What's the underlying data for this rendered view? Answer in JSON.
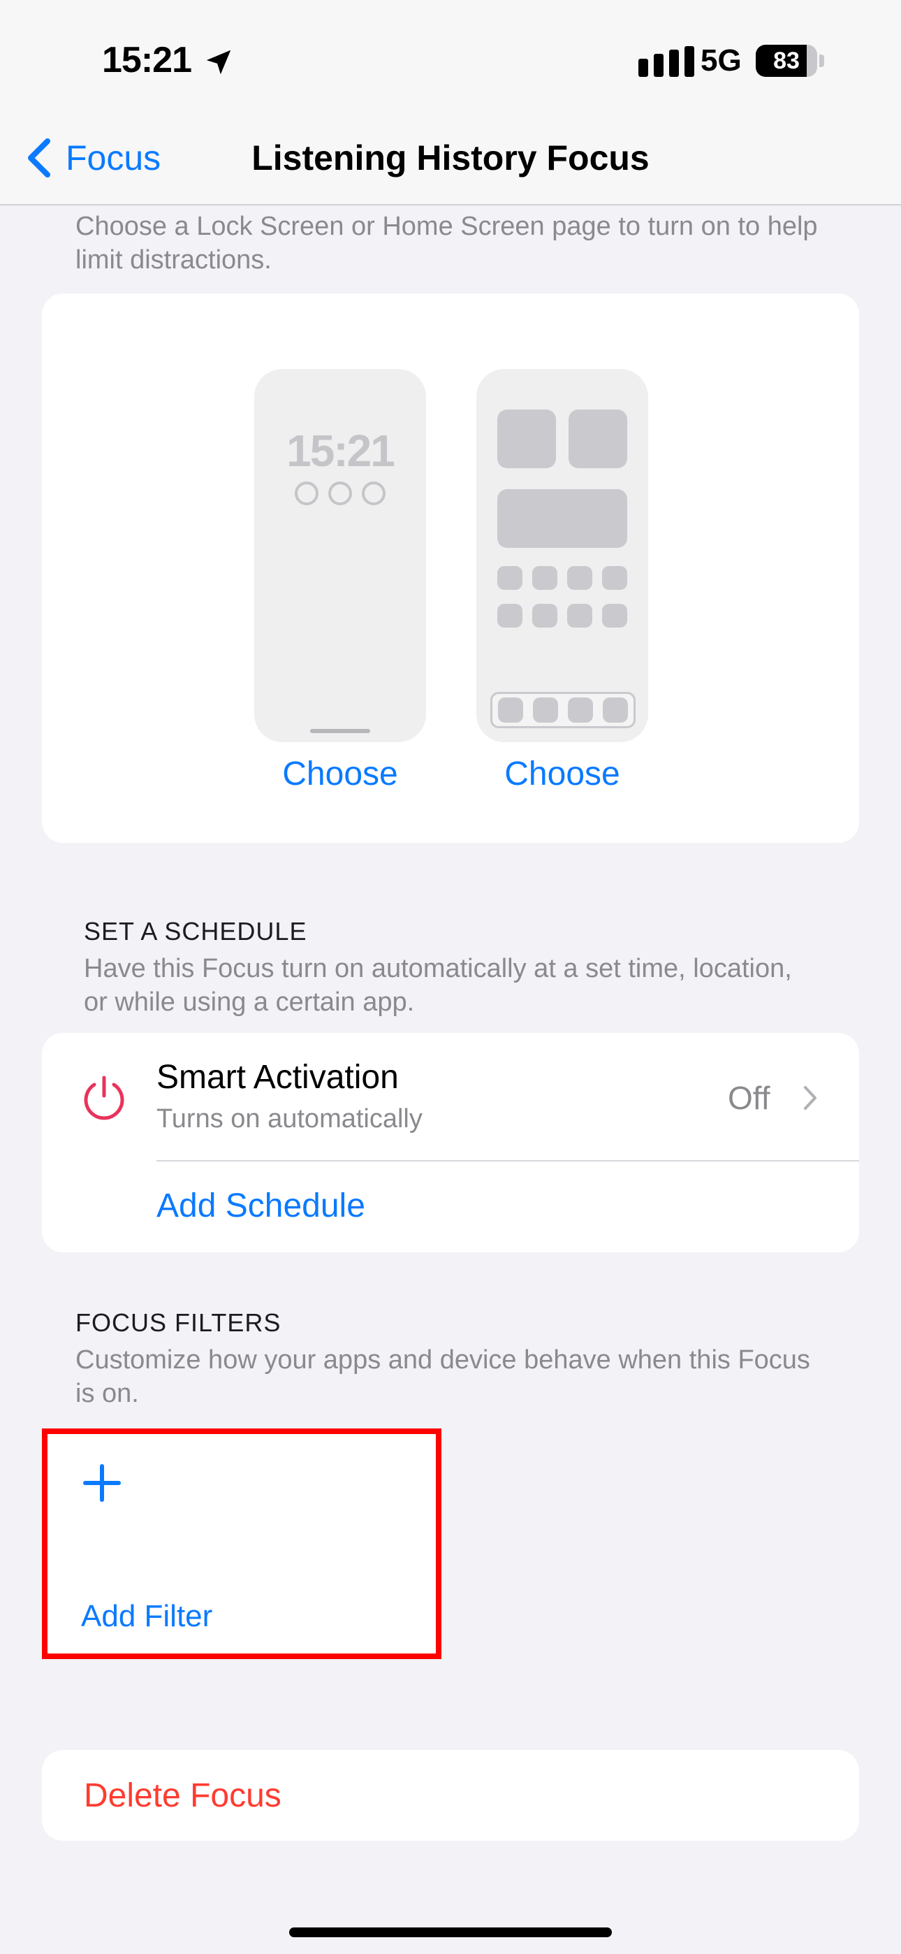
{
  "status_bar": {
    "time": "15:21",
    "network": "5G",
    "battery_level": 83,
    "battery_label": "83"
  },
  "nav": {
    "back_label": "Focus",
    "title": "Listening History Focus"
  },
  "screens_section": {
    "description": "Choose a Lock Screen or Home Screen page to turn on to help limit distractions.",
    "lock_preview_time": "15:21",
    "choose_lock_label": "Choose",
    "choose_home_label": "Choose"
  },
  "schedule_section": {
    "header": "SET A SCHEDULE",
    "description": "Have this Focus turn on automatically at a set time, location, or while using a certain app.",
    "smart_activation": {
      "title": "Smart Activation",
      "subtitle": "Turns on automatically",
      "value": "Off"
    },
    "add_schedule_label": "Add Schedule"
  },
  "filters_section": {
    "header": "FOCUS FILTERS",
    "description": "Customize how your apps and device behave when this Focus is on.",
    "add_filter_label": "Add Filter"
  },
  "delete_label": "Delete Focus",
  "colors": {
    "accent": "#0a7aff",
    "destructive": "#ff3b30",
    "highlight": "#ff0000",
    "smart_icon": "#e8335a"
  }
}
